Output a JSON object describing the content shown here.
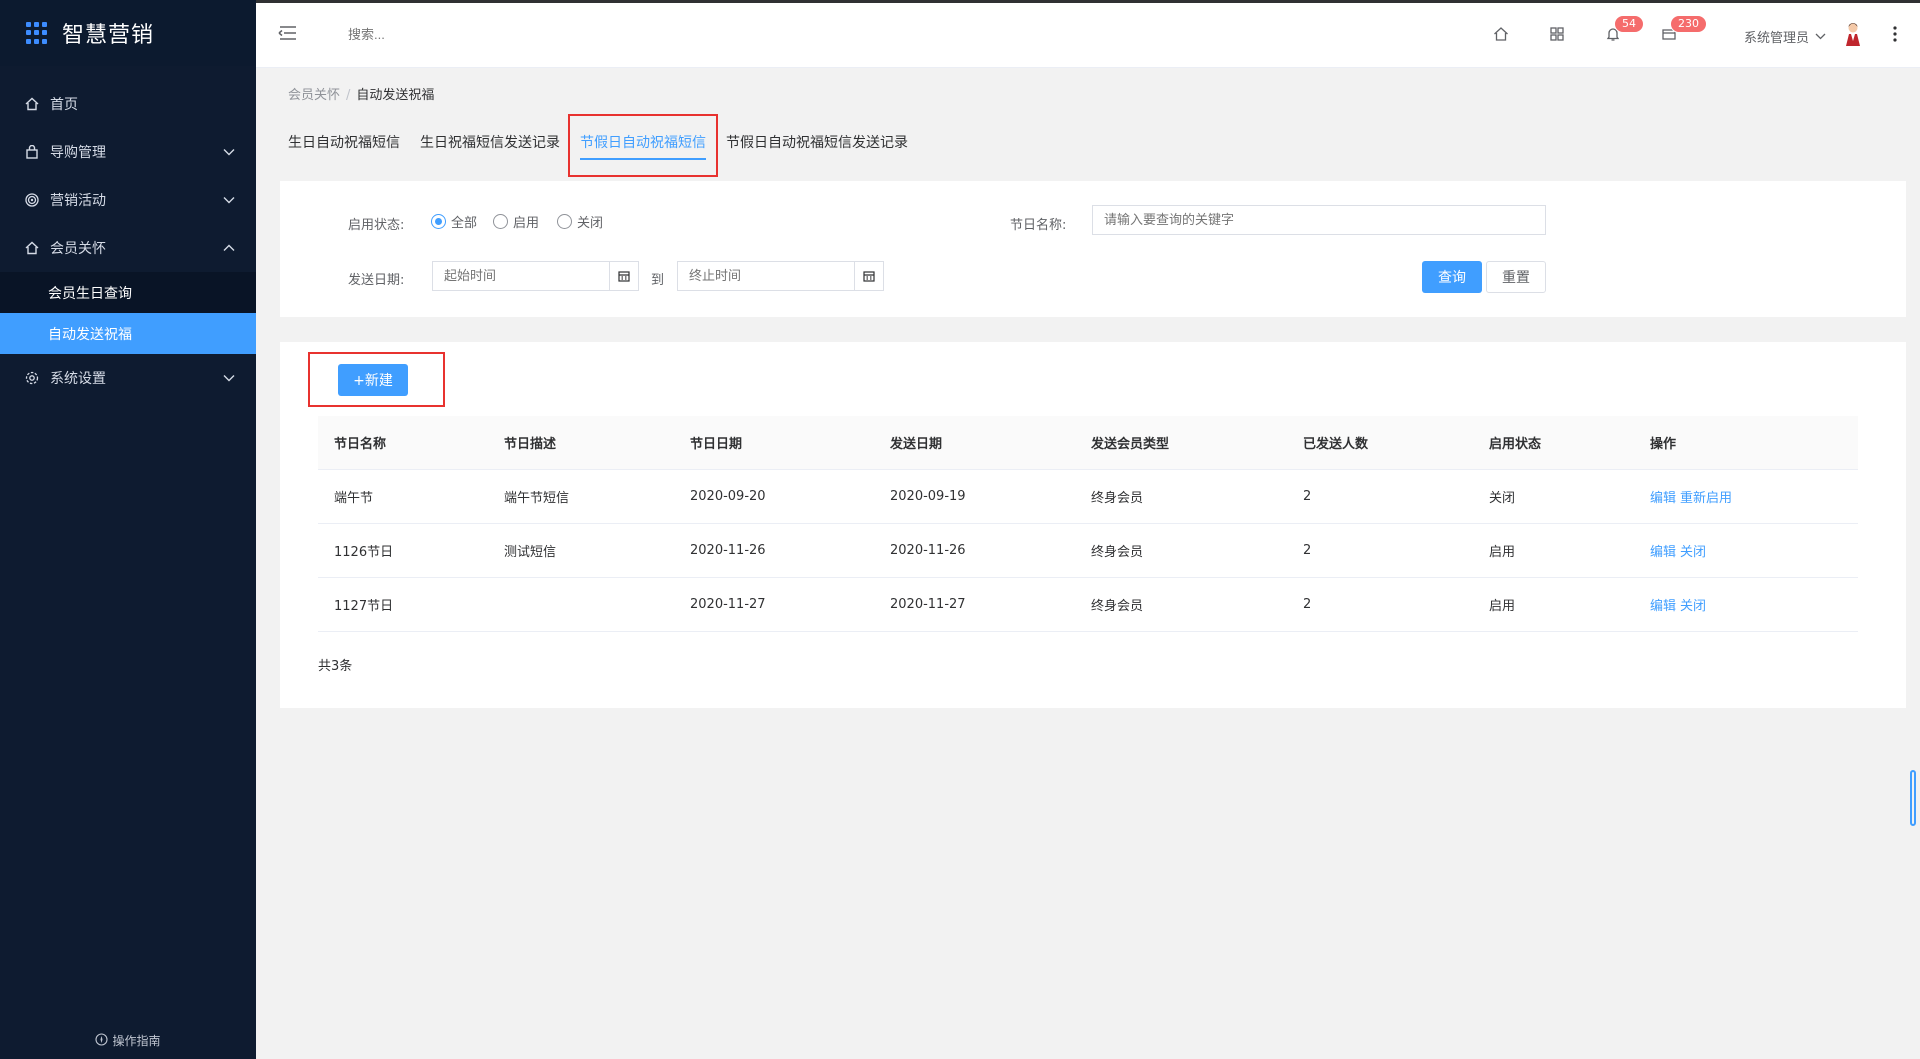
{
  "sidebar": {
    "brand": "智慧营销",
    "items": [
      {
        "label": "首页",
        "icon": "home-icon"
      },
      {
        "label": "导购管理",
        "icon": "bag-icon"
      },
      {
        "label": "营销活动",
        "icon": "target-icon"
      },
      {
        "label": "会员关怀",
        "icon": "home-icon"
      },
      {
        "label": "系统设置",
        "icon": "gear-icon"
      }
    ],
    "sub_items": [
      {
        "label": "会员生日查询"
      },
      {
        "label": "自动发送祝福"
      }
    ],
    "guide": "操作指南"
  },
  "header": {
    "search_placeholder": "搜索...",
    "notification_count": "54",
    "message_count": "230",
    "user_name": "系统管理员"
  },
  "breadcrumb": {
    "parent": "会员关怀",
    "current": "自动发送祝福"
  },
  "tabs": [
    {
      "label": "生日自动祝福短信"
    },
    {
      "label": "生日祝福短信发送记录"
    },
    {
      "label": "节假日自动祝福短信"
    },
    {
      "label": "节假日自动祝福短信发送记录"
    }
  ],
  "filter": {
    "status_label": "启用状态:",
    "status_options": [
      "全部",
      "启用",
      "关闭"
    ],
    "holiday_name_label": "节日名称:",
    "holiday_name_placeholder": "请输入要查询的关键字",
    "send_date_label": "发送日期:",
    "start_placeholder": "起始时间",
    "to_label": "到",
    "end_placeholder": "终止时间",
    "query_button": "查询",
    "reset_button": "重置"
  },
  "table": {
    "new_button": "+新建",
    "columns": [
      "节日名称",
      "节日描述",
      "节日日期",
      "发送日期",
      "发送会员类型",
      "已发送人数",
      "启用状态",
      "操作"
    ],
    "rows": [
      {
        "name": "端午节",
        "desc": "端午节短信",
        "holiday_date": "2020-09-20",
        "send_date": "2020-09-19",
        "member_type": "终身会员",
        "sent": "2",
        "status": "关闭",
        "action1": "编辑",
        "action2": "重新启用"
      },
      {
        "name": "1126节日",
        "desc": "测试短信",
        "holiday_date": "2020-11-26",
        "send_date": "2020-11-26",
        "member_type": "终身会员",
        "sent": "2",
        "status": "启用",
        "action1": "编辑",
        "action2": "关闭"
      },
      {
        "name": "1127节日",
        "desc": "",
        "holiday_date": "2020-11-27",
        "send_date": "2020-11-27",
        "member_type": "终身会员",
        "sent": "2",
        "status": "启用",
        "action1": "编辑",
        "action2": "关闭"
      }
    ],
    "total": "共3条"
  },
  "colors": {
    "accent": "#409eff",
    "sidebar_bg": "#0e1b30",
    "highlight": "#e8322f"
  }
}
